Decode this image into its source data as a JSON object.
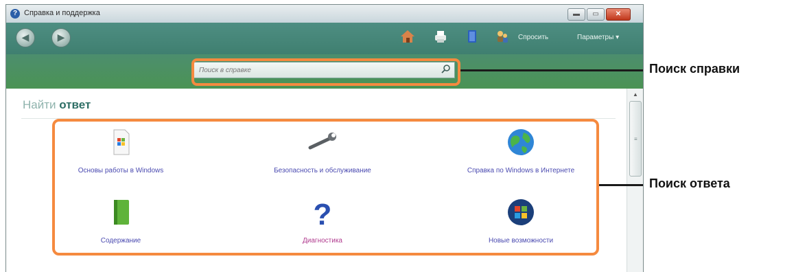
{
  "window": {
    "title": "Справка и поддержка",
    "buttons": {
      "minimize": "▬",
      "maximize": "▭",
      "close": "✕"
    }
  },
  "toolbar": {
    "back": "◀",
    "forward": "▶",
    "icons": [
      "home-icon",
      "print-icon",
      "browse-help-icon",
      "ask-icon"
    ],
    "ask_label": "Спросить",
    "options_label": "Параметры ▾"
  },
  "search": {
    "placeholder": "Поиск в справке"
  },
  "find_answer": {
    "title_light": "Найти ",
    "title_bold": "ответ",
    "items": [
      {
        "label": "Основы работы в Windows",
        "icon": "document-icon",
        "color": "#4a4ab0"
      },
      {
        "label": "Безопасность и обслуживание",
        "icon": "wrench-icon",
        "color": "#4a4ab0"
      },
      {
        "label": "Справка по Windows в Интернете",
        "icon": "globe-icon",
        "color": "#4a4ab0"
      },
      {
        "label": "Содержание",
        "icon": "book-icon",
        "color": "#4a4ab0"
      },
      {
        "label": "Диагностика",
        "icon": "question-icon",
        "color": "#b03a8e"
      },
      {
        "label": "Новые возможности",
        "icon": "windows-logo-icon",
        "color": "#4a4ab0"
      }
    ]
  },
  "callouts": {
    "search": "Поиск справки",
    "answer": "Поиск ответа"
  },
  "colors": {
    "highlight": "#f58a3f",
    "nav_green": "#4e8e82"
  }
}
